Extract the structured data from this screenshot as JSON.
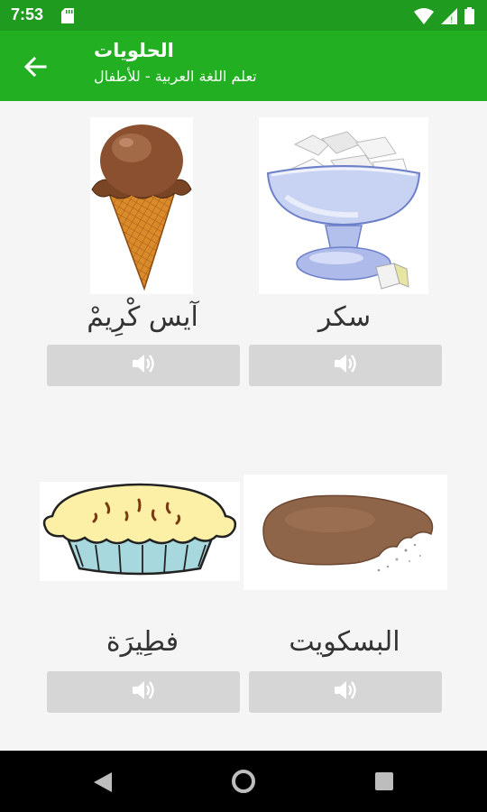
{
  "status_bar": {
    "time": "7:53"
  },
  "app_bar": {
    "title": "الحلويات",
    "subtitle": "تعلم اللغة العربية - للأطفال"
  },
  "cards": [
    {
      "word": "آيس كْرِيمْ",
      "image": "ice-cream"
    },
    {
      "word": "سكر",
      "image": "sugar-bowl"
    },
    {
      "word": "فطِيرَة",
      "image": "pie"
    },
    {
      "word": "البسكويت",
      "image": "biscuit"
    }
  ],
  "icons": {
    "play": "speaker-icon",
    "back": "arrow-left-icon"
  },
  "colors": {
    "app_bar": "#22b022",
    "status_bar": "#1f9b1f",
    "button": "#d6d6d6",
    "background": "#f5f5f5"
  }
}
